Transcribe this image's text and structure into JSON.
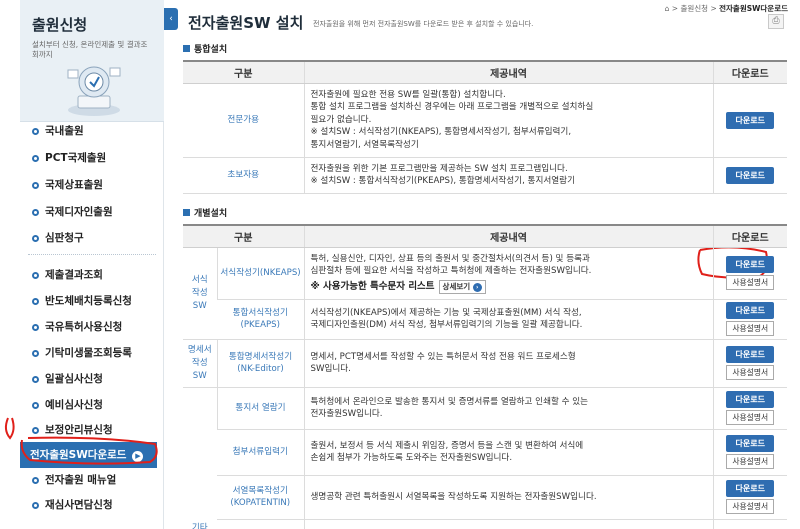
{
  "sidebar": {
    "title": "출원신청",
    "description": "설치부터 신청, 온라인제출 및 결과조회까지",
    "collapse_glyph": "‹",
    "items_top": [
      {
        "label": "국내출원"
      },
      {
        "label": "PCT국제출원"
      },
      {
        "label": "국제상표출원"
      },
      {
        "label": "국제디자인출원"
      },
      {
        "label": "심판청구"
      }
    ],
    "items_bottom": [
      {
        "label": "제출결과조회"
      },
      {
        "label": "반도체배치등록신청"
      },
      {
        "label": "국유특허사용신청"
      },
      {
        "label": "기탁미생물조회등록"
      },
      {
        "label": "일괄심사신청"
      },
      {
        "label": "예비심사신청"
      },
      {
        "label": "보정안리뷰신청"
      },
      {
        "label": "전자출원SW다운로드",
        "active": true
      },
      {
        "label": "전자출원 매뉴얼"
      },
      {
        "label": "재심사면담신청"
      }
    ]
  },
  "breadcrumb": {
    "home": "⌂",
    "sep": ">",
    "level1": "출원신청",
    "current": "전자출원SW다운로드"
  },
  "page": {
    "title": "전자출원SW 설치",
    "subtitle": "전자출원을 위해 먼저 전자출원SW를 다운로드 받은 후 설치할 수 있습니다.",
    "print_icon": "⎙"
  },
  "integrated": {
    "heading": "통합설치",
    "headers": [
      "구분",
      "제공내역",
      "다운로드"
    ],
    "rows": [
      {
        "category": "전문가용",
        "lines": [
          "전자출원에 필요한 전용 SW를 일괄(통합) 설치합니다.",
          "통합 설치 프로그램을 설치하신 경우에는 아래 프로그램을 개별적으로 설치하실",
          "필요가 없습니다.",
          "※ 설치SW : 서식작성기(NKEAPS), 통합명세서작성기, 첨부서류입력기,",
          "통지서열람기, 서열목록작성기"
        ],
        "download": "다운로드"
      },
      {
        "category": "초보자용",
        "lines": [
          "전자출원을 위한 기본 프로그램만을 제공하는 SW 설치 프로그램입니다.",
          "※ 설치SW : 통합서식작성기(PKEAPS), 통합명세서작성기, 통지서열람기"
        ],
        "download": "다운로드"
      }
    ]
  },
  "individual": {
    "heading": "개별설치",
    "headers": [
      "구분",
      "제공내역",
      "다운로드"
    ],
    "groups": [
      {
        "label": "서식\n작성\nSW"
      },
      {
        "label": "명세서\n작성\nSW"
      },
      {
        "label": "기타"
      }
    ],
    "rows": [
      {
        "name": "서식작성기(NKEAPS)",
        "lines": [
          "특허, 실용신안, 디자인, 상표 등의 출원서 및 중간절차서(의견서 등) 및 등록과",
          "심판절차 등에 필요한 서식을 작성하고 특허청에 제출하는 전자출원SW입니다."
        ],
        "notice": "※ 사용가능한 특수문자 리스트",
        "detail": "상세보기",
        "detail_icon": "›",
        "download": "다운로드",
        "manual": "사용설명서"
      },
      {
        "name": "통합서식작성기\n(PKEAPS)",
        "lines": [
          "서식작성기(NKEAPS)에서 제공하는 기능 및 국제상표출원(MM) 서식 작성,",
          "국제디자인출원(DM) 서식 작성, 첨부서류입력기의 기능을 일괄 제공합니다."
        ],
        "download": "다운로드",
        "manual": "사용설명서"
      },
      {
        "name": "통합명세서작성기\n(NK-Editor)",
        "lines": [
          "명세서, PCT명세서를 작성할 수 있는 특허문서 작성 전용 워드 프로세스형",
          "SW입니다."
        ],
        "download": "다운로드",
        "manual": "사용설명서"
      },
      {
        "name": "통지서 열람기",
        "lines": [
          "특허청에서 온라인으로 발송한 통지서 및 증명서류를 열람하고 인쇄할 수 있는",
          "전자출원SW입니다."
        ],
        "download": "다운로드",
        "manual": "사용설명서"
      },
      {
        "name": "첨부서류입력기",
        "lines": [
          "출원서, 보정서 등 서식 제출시 위임장, 증명서 등을 스캔 및 변환하여 서식에",
          "손쉽게 첨부가 가능하도록 도와주는 전자출원SW입니다."
        ],
        "download": "다운로드",
        "manual": "사용설명서"
      },
      {
        "name": "서열목록작성기\n(KOPATENTIN)",
        "lines": [
          "생명공학 관련 특허출원시 서열목록을 작성하도록 지원하는 전자출원SW입니다."
        ],
        "download": "다운로드",
        "manual": "사용설명서"
      }
    ]
  },
  "annotations": {
    "mark_1": "1",
    "mark_2": "2"
  }
}
